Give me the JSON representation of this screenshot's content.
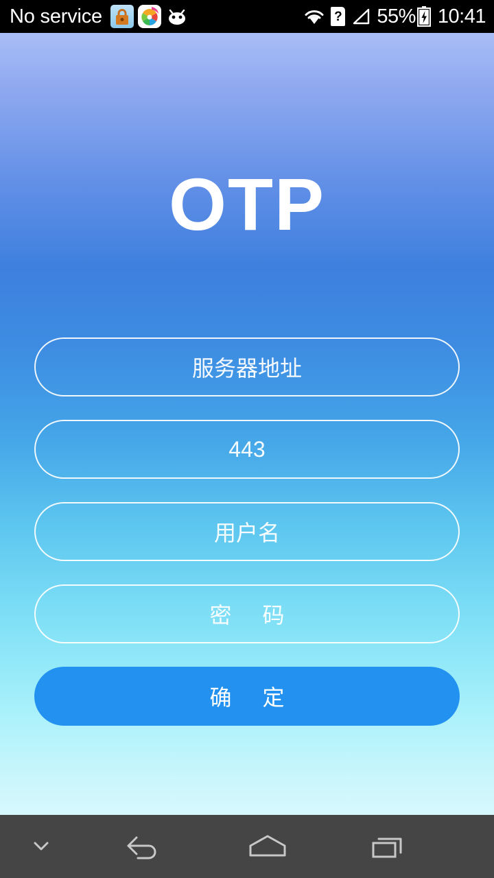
{
  "status_bar": {
    "carrier": "No service",
    "notification_icons": [
      {
        "name": "lock-icon"
      },
      {
        "name": "pinwheel-app-icon"
      },
      {
        "name": "cyanogen-robot-icon"
      }
    ],
    "wifi_icon": "wifi-icon",
    "sim_icon": "sim-missing-icon",
    "sim_glyph": "?",
    "signal_icon": "signal-empty-icon",
    "battery_percent": "55%",
    "battery_icon": "battery-charging-icon",
    "clock": "10:41",
    "background_color": "#000000",
    "text_color": "#ffffff"
  },
  "app": {
    "title": "OTP",
    "wallpaper_colors": {
      "top": "#a9bdf6",
      "upper_mid": "#3e80de",
      "lower_mid": "#7adcf5",
      "bottom": "#d6f8fd"
    }
  },
  "form": {
    "fields": [
      {
        "name": "server-address-input",
        "placeholder": "服务器地址",
        "value": "",
        "type": "text"
      },
      {
        "name": "port-input",
        "placeholder": "443",
        "value": "",
        "type": "number"
      },
      {
        "name": "username-input",
        "placeholder": "用户名",
        "value": "",
        "type": "text"
      },
      {
        "name": "password-input",
        "placeholder": "密  码",
        "value": "",
        "type": "password"
      }
    ],
    "submit": {
      "label": "确  定",
      "background_color": "#2391ef",
      "text_color": "#ffffff"
    },
    "field_border_color": "#ffffff"
  },
  "nav_bar": {
    "background_color": "#454545",
    "icon_color": "#c8c8c8",
    "buttons": [
      {
        "name": "hide-keyboard-icon"
      },
      {
        "name": "back-icon"
      },
      {
        "name": "home-icon"
      },
      {
        "name": "recents-icon"
      }
    ]
  }
}
